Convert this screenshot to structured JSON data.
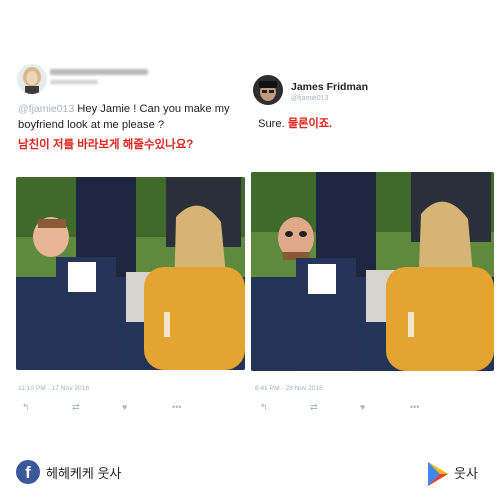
{
  "left_tweet": {
    "handle_prefix": "@fjamie013",
    "text_line1": "Hey Jamie ! Can you make my",
    "text_line2": "boyfriend look at me please ?",
    "korean": "남친이 저를 바라보게 해줄수있나요?",
    "timestamp": "11:10 PM - 17 Nov 2016",
    "actions": [
      "reply-icon",
      "retweet-icon",
      "like-icon",
      "more-icon"
    ]
  },
  "right_tweet": {
    "display_name": "James Fridman",
    "handle": "@fjamie013",
    "text_sure": "Sure.",
    "text_korean": "물론이죠.",
    "timestamp": "6:41 PM - 28 Nov 2016",
    "actions": [
      "reply-icon",
      "retweet-icon",
      "like-icon",
      "more-icon"
    ]
  },
  "icons": {
    "reply": "↰",
    "retweet": "⇄",
    "like": "♥",
    "more": "•••"
  },
  "footer": {
    "facebook_letter": "f",
    "facebook_label": "헤헤케케 웃사",
    "play_label": "웃사"
  },
  "colors": {
    "korean_red": "#e0231c",
    "handle_gray": "#a9b3bd",
    "facebook_blue": "#3b5998"
  }
}
